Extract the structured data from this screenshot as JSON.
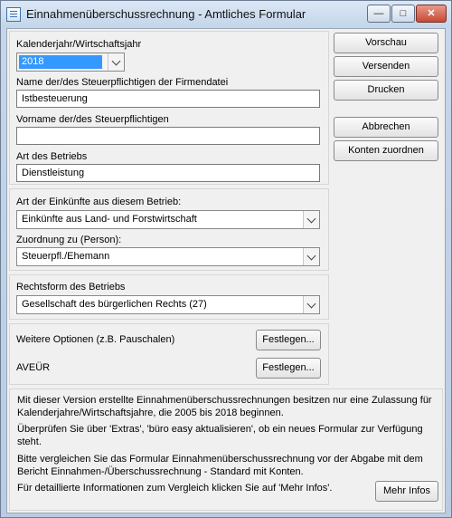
{
  "window": {
    "title": "Einnahmenüberschussrechnung - Amtliches Formular",
    "controls": {
      "minimize": "—",
      "maximize": "□",
      "close": "✕"
    }
  },
  "form": {
    "year_label": "Kalenderjahr/Wirtschaftsjahr",
    "year_value": "2018",
    "name_label": "Name der/des Steuerpflichtigen der Firmendatei",
    "name_value": "Istbesteuerung",
    "firstname_label": "Vorname der/des Steuerpflichtigen",
    "firstname_value": "",
    "business_type_label": "Art des Betriebs",
    "business_type_value": "Dienstleistung",
    "income_type_label": "Art der Einkünfte aus diesem Betrieb:",
    "income_type_value": "Einkünfte aus Land- und Forstwirtschaft",
    "assignment_label": "Zuordnung zu (Person):",
    "assignment_value": "Steuerpfl./Ehemann",
    "legal_form_label": "Rechtsform des Betriebs",
    "legal_form_value": "Gesellschaft des bürgerlichen Rechts (27)",
    "options_label": "Weitere Optionen (z.B. Pauschalen)",
    "options_button": "Festlegen...",
    "aveur_label": "AVEÜR",
    "aveur_button": "Festlegen..."
  },
  "actions": {
    "preview": "Vorschau",
    "send": "Versenden",
    "print": "Drucken",
    "cancel": "Abbrechen",
    "assign_accounts": "Konten zuordnen"
  },
  "info": {
    "line1": "Mit dieser Version erstellte Einnahmenüberschussrechnungen besitzen nur eine Zulassung für Kalenderjahre/Wirtschaftsjahre, die 2005 bis 2018 beginnen.",
    "line2": "Überprüfen Sie über 'Extras', 'büro easy aktualisieren', ob ein neues Formular zur Verfügung steht.",
    "line3": "Bitte vergleichen Sie das Formular Einnahmenüberschussrechnung vor der Abgabe mit dem Bericht Einnahmen-/Überschussrechnung - Standard mit Konten.",
    "line4": "Für detaillierte Informationen zum Vergleich klicken Sie auf 'Mehr Infos'.",
    "more_button": "Mehr Infos"
  }
}
